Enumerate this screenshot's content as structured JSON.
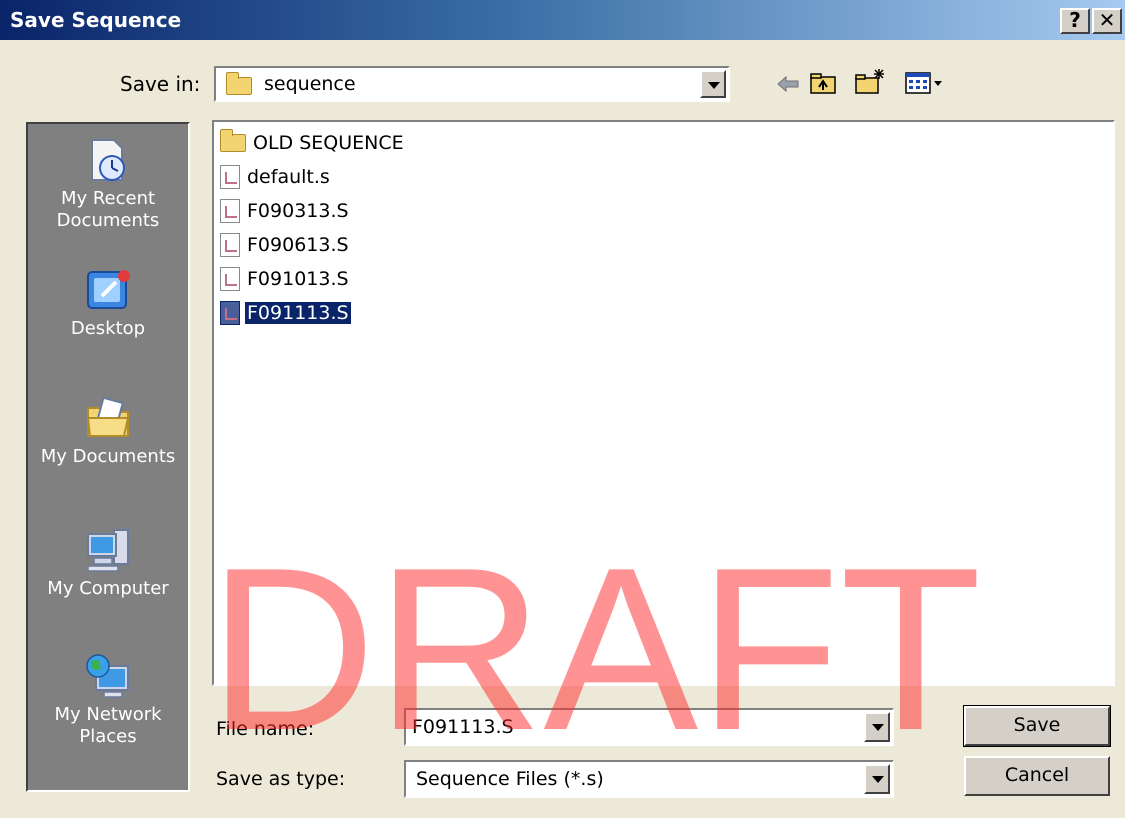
{
  "window": {
    "title": "Save Sequence",
    "help_label": "?",
    "close_label": "✕"
  },
  "toolbar": {
    "save_in_label": "Save in:",
    "save_in_value": "sequence",
    "back_icon": "back-arrow-icon",
    "up_icon": "up-folder-icon",
    "new_folder_icon": "new-folder-icon",
    "views_icon": "views-menu-icon"
  },
  "places": [
    {
      "label": "My Recent Documents",
      "icon": "recent-documents-icon"
    },
    {
      "label": "Desktop",
      "icon": "desktop-icon"
    },
    {
      "label": "My Documents",
      "icon": "my-documents-icon"
    },
    {
      "label": "My Computer",
      "icon": "my-computer-icon"
    },
    {
      "label": "My Network Places",
      "icon": "network-places-icon"
    }
  ],
  "files": [
    {
      "name": "OLD SEQUENCE",
      "type": "folder"
    },
    {
      "name": "default.s",
      "type": "file"
    },
    {
      "name": "F090313.S",
      "type": "file"
    },
    {
      "name": "F090613.S",
      "type": "file"
    },
    {
      "name": "F091013.S",
      "type": "file"
    },
    {
      "name": "F091113.S",
      "type": "file",
      "selected": true
    }
  ],
  "form": {
    "file_name_label": "File name:",
    "file_name_value": "F091113.S",
    "save_as_type_label": "Save as type:",
    "save_as_type_value": "Sequence Files (*.s)"
  },
  "buttons": {
    "save_label": "Save",
    "cancel_label": "Cancel"
  },
  "watermark": "DRAFT"
}
